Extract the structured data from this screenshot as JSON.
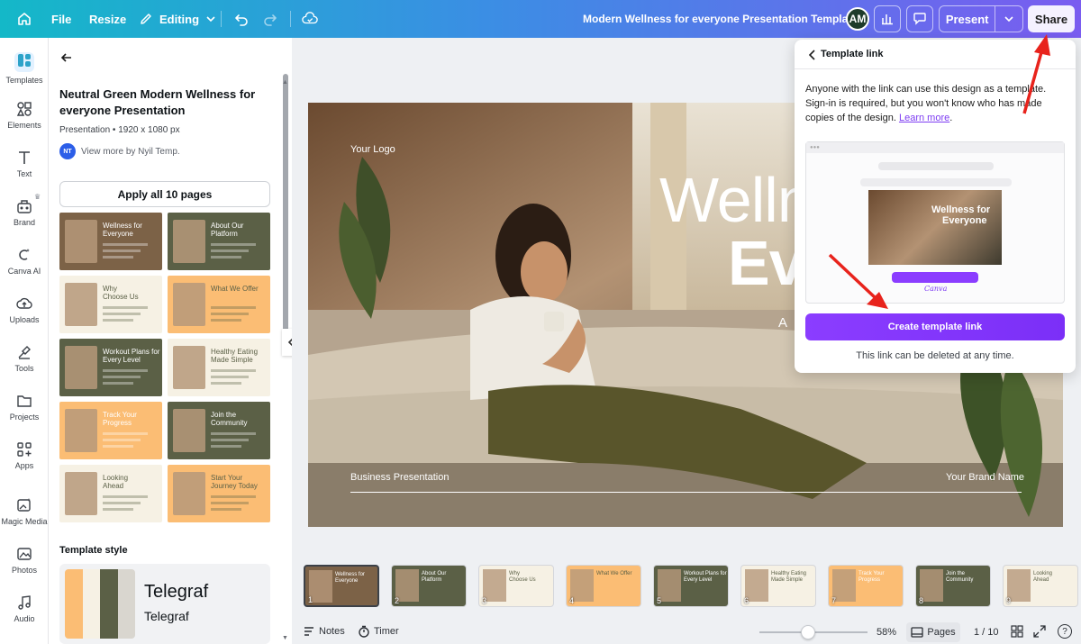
{
  "topbar": {
    "file": "File",
    "resize": "Resize",
    "editing": "Editing",
    "doc_title": "Modern Wellness for everyone Presentation Template",
    "avatar": "AM",
    "present": "Present",
    "share": "Share"
  },
  "rail": [
    {
      "label": "Templates",
      "icon": "templates-icon"
    },
    {
      "label": "Elements",
      "icon": "elements-icon"
    },
    {
      "label": "Text",
      "icon": "text-icon"
    },
    {
      "label": "Brand",
      "icon": "brand-icon"
    },
    {
      "label": "Canva AI",
      "icon": "canva-ai-icon"
    },
    {
      "label": "Uploads",
      "icon": "uploads-icon"
    },
    {
      "label": "Tools",
      "icon": "tools-icon"
    },
    {
      "label": "Projects",
      "icon": "projects-icon"
    },
    {
      "label": "Apps",
      "icon": "apps-icon"
    },
    {
      "label": "Magic Media",
      "icon": "magic-media-icon"
    },
    {
      "label": "Photos",
      "icon": "photos-icon"
    },
    {
      "label": "Audio",
      "icon": "audio-icon"
    }
  ],
  "panel": {
    "title": "Neutral Green Modern Wellness for everyone Presentation",
    "meta": "Presentation • 1920 x 1080 px",
    "author_initials": "NT",
    "author": "View more by Nyil Temp.",
    "apply_button": "Apply all 10 pages",
    "thumbs": [
      {
        "t1": "Wellness for",
        "t2": "Everyone"
      },
      {
        "t1": "About Our",
        "t2": "Platform"
      },
      {
        "t1": "Why",
        "t2": "Choose Us"
      },
      {
        "t1": "What We Offer",
        "t2": ""
      },
      {
        "t1": "Workout Plans for",
        "t2": "Every Level"
      },
      {
        "t1": "Healthy Eating",
        "t2": "Made Simple"
      },
      {
        "t1": "Track Your",
        "t2": "Progress"
      },
      {
        "t1": "Join the",
        "t2": "Community"
      },
      {
        "t1": "Looking",
        "t2": "Ahead"
      },
      {
        "t1": "Start Your",
        "t2": "Journey Today"
      }
    ],
    "style_heading": "Template style",
    "style_font1": "Telegraf",
    "style_font2": "Telegraf"
  },
  "slide": {
    "logo": "Your Logo",
    "big1": "Welln",
    "big2": "Ev",
    "sub": "A n",
    "footer_left": "Business Presentation",
    "footer_right": "Your Brand Name"
  },
  "popup": {
    "header": "Template link",
    "description_pre": "Anyone with the link can use this design as a template. Sign-in is required, but you won't know who has made copies of the design. ",
    "learn_more": "Learn more",
    "description_post": ".",
    "preview_title1": "Wellness for",
    "preview_title2": "Everyone",
    "preview_brand": "Canva",
    "create_button": "Create template link",
    "footnote": "This link can be deleted at any time."
  },
  "strip": [
    {
      "num": "1",
      "t1": "Wellness for",
      "t2": "Everyone"
    },
    {
      "num": "2",
      "t1": "About Our",
      "t2": "Platform"
    },
    {
      "num": "3",
      "t1": "Why",
      "t2": "Choose Us"
    },
    {
      "num": "4",
      "t1": "What We Offer",
      "t2": ""
    },
    {
      "num": "5",
      "t1": "Workout Plans for",
      "t2": "Every Level"
    },
    {
      "num": "6",
      "t1": "Healthy Eating",
      "t2": "Made Simple"
    },
    {
      "num": "7",
      "t1": "Track Your",
      "t2": "Progress"
    },
    {
      "num": "8",
      "t1": "Join the",
      "t2": "Community"
    },
    {
      "num": "9",
      "t1": "Looking",
      "t2": "Ahead"
    }
  ],
  "bottombar": {
    "notes": "Notes",
    "timer": "Timer",
    "zoom": "58%",
    "pages": "Pages",
    "page_counter": "1 / 10"
  },
  "colors": {
    "accent_purple": "#8b3dff",
    "olive": "#5b6046",
    "peach": "#fbbd74",
    "cream": "#f6f1e4",
    "arrow_red": "#e8231c"
  }
}
